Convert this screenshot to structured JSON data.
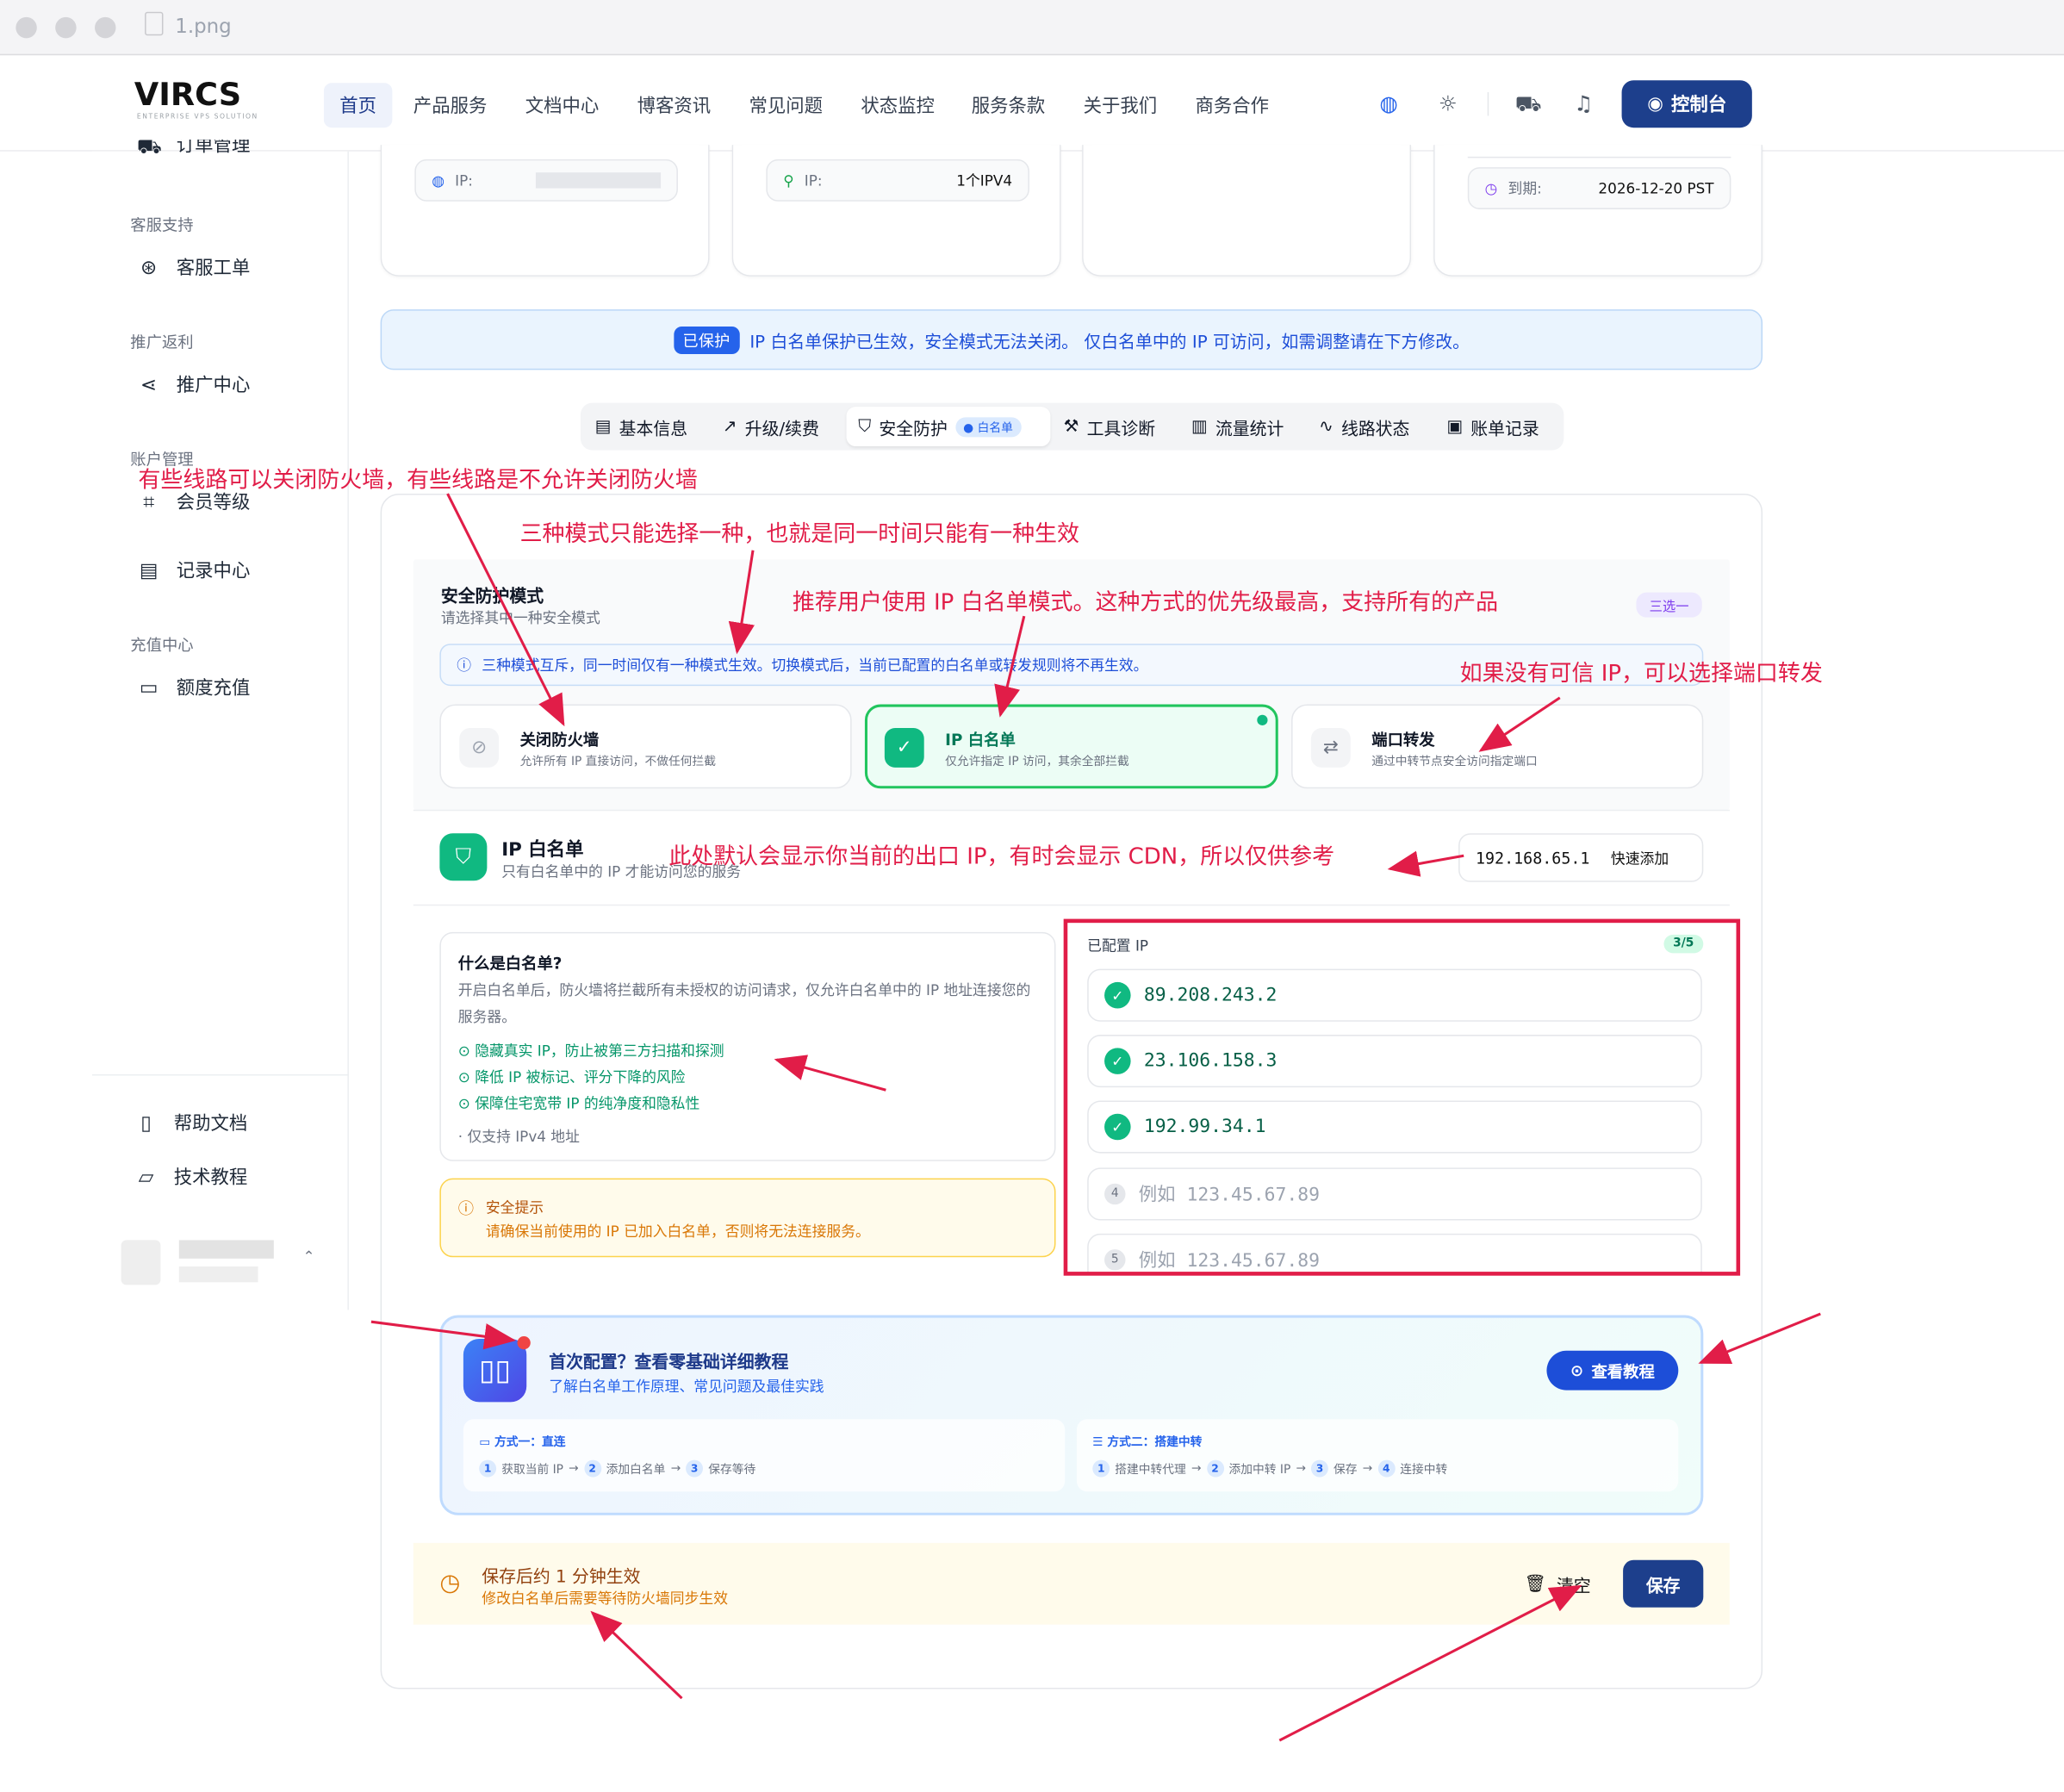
{
  "window": {
    "title": "1.png"
  },
  "brand": {
    "logo": "VIRCS",
    "tagline": "ENTERPRISE VPS SOLUTION"
  },
  "nav": {
    "items": [
      "首页",
      "产品服务",
      "文档中心",
      "博客资讯",
      "常见问题",
      "状态监控",
      "服务条款",
      "关于我们",
      "商务合作"
    ],
    "console": "控制台"
  },
  "sidebar": {
    "partial_top": "订单管理",
    "groups": [
      {
        "title": "客服支持",
        "items": [
          "客服工单"
        ]
      },
      {
        "title": "推广返利",
        "items": [
          "推广中心"
        ]
      },
      {
        "title": "账户管理",
        "items": [
          "会员等级",
          "记录中心"
        ]
      },
      {
        "title": "充值中心",
        "items": [
          "额度充值"
        ]
      }
    ],
    "bottom": [
      "帮助文档",
      "技术教程"
    ]
  },
  "top_cards": {
    "ip_label": "IP:",
    "ip2_label": "IP:",
    "ip2_value": "1个IPV4",
    "expire_label": "到期:",
    "expire_value": "2026-12-20 PST"
  },
  "banner": {
    "badge": "已保护",
    "text": "IP 白名单保护已生效，安全模式无法关闭。 仅白名单中的 IP 可访问，如需调整请在下方修改。"
  },
  "tabs": [
    "基本信息",
    "升级/续费",
    "安全防护",
    "工具诊断",
    "流量统计",
    "线路状态",
    "账单记录"
  ],
  "tab_badge": "白名单",
  "security": {
    "title": "安全防护模式",
    "subtitle": "请选择其中一种安全模式",
    "badge": "三选一",
    "info": "三种模式互斥，同一时间仅有一种模式生效。切换模式后，当前已配置的白名单或转发规则将不再生效。",
    "modes": [
      {
        "title": "关闭防火墙",
        "desc": "允许所有 IP 直接访问，不做任何拦截"
      },
      {
        "title": "IP 白名单",
        "desc": "仅允许指定 IP 访问，其余全部拦截"
      },
      {
        "title": "端口转发",
        "desc": "通过中转节点安全访问指定端口"
      }
    ]
  },
  "whitelist": {
    "title": "IP 白名单",
    "subtitle": "只有白名单中的 IP 才能访问您的服务",
    "current_ip": "192.168.65.1",
    "quick_add": "快速添加"
  },
  "what": {
    "title": "什么是白名单?",
    "desc": "开启白名单后，防火墙将拦截所有未授权的访问请求，仅允许白名单中的 IP 地址连接您的服务器。",
    "points": [
      "隐藏真实 IP，防止被第三方扫描和探测",
      "降低 IP 被标记、评分下降的风险",
      "保障住宅宽带 IP 的纯净度和隐私性"
    ],
    "note": "· 仅支持 IPv4 地址"
  },
  "tip": {
    "title": "安全提示",
    "text": "请确保当前使用的 IP 已加入白名单，否则将无法连接服务。"
  },
  "configured": {
    "label": "已配置 IP",
    "count": "3/5",
    "ips": [
      "89.208.243.2",
      "23.106.158.3",
      "192.99.34.1"
    ],
    "placeholders": [
      {
        "n": "4",
        "text": "例如  123.45.67.89"
      },
      {
        "n": "5",
        "text": "例如  123.45.67.89"
      }
    ]
  },
  "tutorial": {
    "title": "首次配置？查看零基础详细教程",
    "subtitle": "了解白名单工作原理、常见问题及最佳实践",
    "button": "查看教程",
    "m1": {
      "title": "方式一：直连",
      "steps": [
        "1",
        "获取当前 IP",
        "2",
        "添加白名单",
        "3",
        "保存等待"
      ]
    },
    "m2": {
      "title": "方式二：搭建中转",
      "steps": [
        "1",
        "搭建中转代理",
        "2",
        "添加中转 IP",
        "3",
        "保存",
        "4",
        "连接中转"
      ]
    }
  },
  "save": {
    "title": "保存后约 1 分钟生效",
    "subtitle": "修改白名单后需要等待防火墙同步生效",
    "clear": "清空",
    "save": "保存"
  },
  "annotations": [
    "有些线路可以关闭防火墙，有些线路是不允许关闭防火墙",
    "三种模式只能选择一种，也就是同一时间只能有一种生效",
    "推荐用户使用 IP 白名单模式。这种方式的优先级最高，支持所有的产品",
    "如果没有可信 IP，可以选择端口转发",
    "此处默认会显示你当前的出口 IP，有时会显示 CDN，所以仅供参考"
  ],
  "colors": {
    "primary": "#1d3f8c",
    "accent": "#10b981",
    "annotation": "#e11d48"
  }
}
